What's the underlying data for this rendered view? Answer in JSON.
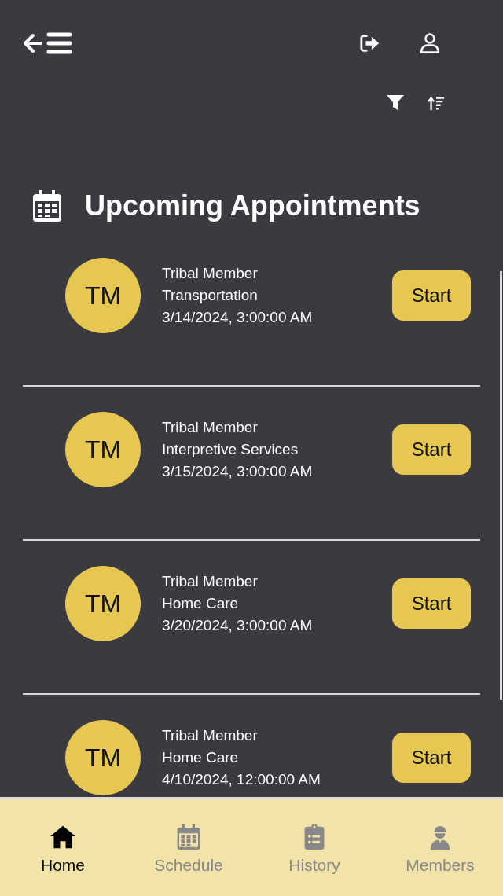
{
  "section": {
    "title": "Upcoming Appointments"
  },
  "appointments": [
    {
      "initials": "TM",
      "member": "Tribal Member",
      "service": "Transportation",
      "datetime": "3/14/2024, 3:00:00 AM",
      "action": "Start"
    },
    {
      "initials": "TM",
      "member": "Tribal Member",
      "service": "Interpretive Services",
      "datetime": "3/15/2024, 3:00:00 AM",
      "action": "Start"
    },
    {
      "initials": "TM",
      "member": "Tribal Member",
      "service": "Home Care",
      "datetime": "3/20/2024, 3:00:00 AM",
      "action": "Start"
    },
    {
      "initials": "TM",
      "member": "Tribal Member",
      "service": "Home Care",
      "datetime": "4/10/2024, 12:00:00 AM",
      "action": "Start"
    }
  ],
  "nav": [
    {
      "kind": "home",
      "label": "Home",
      "selected": true
    },
    {
      "kind": "schedule",
      "label": "Schedule",
      "selected": false
    },
    {
      "kind": "history",
      "label": "History",
      "selected": false
    },
    {
      "kind": "members",
      "label": "Members",
      "selected": false
    }
  ]
}
